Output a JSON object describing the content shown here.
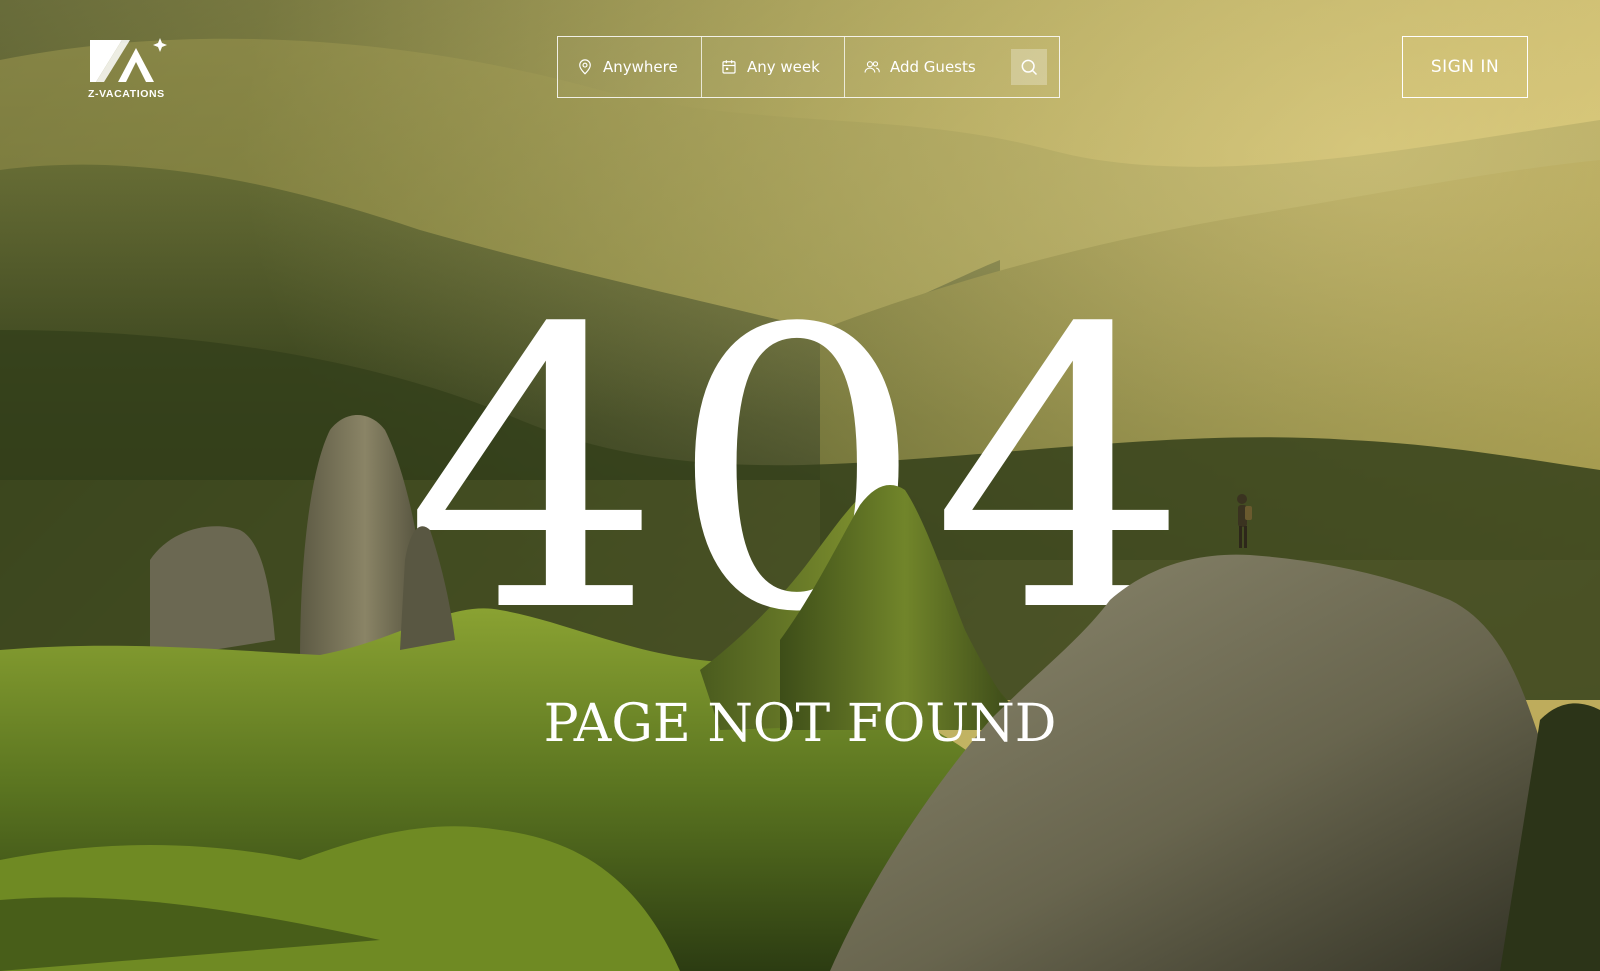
{
  "brand": {
    "logo_text": "Z-VACATIONS",
    "logo_icon": "z-vacations-logo-icon"
  },
  "search": {
    "location": {
      "label": "Anywhere",
      "icon": "map-pin-icon"
    },
    "dates": {
      "label": "Any week",
      "icon": "calendar-icon"
    },
    "guests": {
      "label": "Add Guests",
      "icon": "users-icon"
    },
    "submit_icon": "search-icon"
  },
  "header": {
    "signin_label": "SIGN IN"
  },
  "error": {
    "code": "404",
    "message": "PAGE NOT FOUND"
  },
  "colors": {
    "text": "#ffffff",
    "sky": "#b9a94e",
    "forest": "#3d4a21",
    "meadow": "#7d9a2a",
    "rock": "#6e6a58"
  }
}
